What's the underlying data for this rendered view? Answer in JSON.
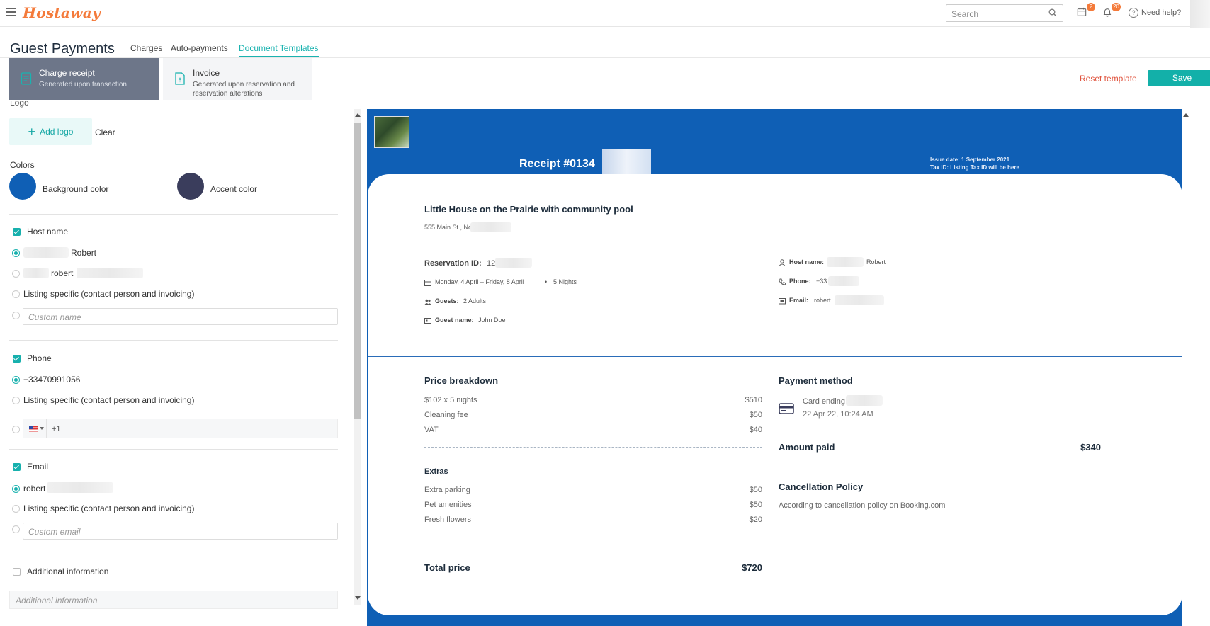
{
  "app": {
    "logo_text": "Hostaway",
    "search_placeholder": "Search",
    "calendar_badge": "2",
    "notifications_badge": "20",
    "help_label": "Need help?"
  },
  "page": {
    "title": "Guest Payments",
    "tabs": [
      {
        "label": "Charges"
      },
      {
        "label": "Auto-payments"
      },
      {
        "label": "Document Templates"
      }
    ]
  },
  "templates": [
    {
      "title": "Charge receipt",
      "subtitle": "Generated upon transaction"
    },
    {
      "title": "Invoice",
      "subtitle": "Generated upon reservation and reservation alterations"
    }
  ],
  "actions": {
    "reset_label": "Reset template",
    "save_label": "Save"
  },
  "editor": {
    "logo_label": "Logo",
    "add_logo_label": "Add logo",
    "clear_label": "Clear",
    "colors_label": "Colors",
    "background_color_label": "Background color",
    "accent_color_label": "Accent color",
    "background_color": "#0f5fb5",
    "accent_color": "#3a3d5c",
    "host_name": {
      "label": "Host name",
      "option1": "Robert",
      "option2": "robert",
      "option3": "Listing specific (contact person and invoicing)",
      "custom_placeholder": "Custom name"
    },
    "phone": {
      "label": "Phone",
      "option1": "+33470991056",
      "option2": "Listing specific (contact person and invoicing)",
      "custom_prefix": "+1"
    },
    "email": {
      "label": "Email",
      "option1": "robert",
      "option2": "Listing specific (contact person and invoicing)",
      "custom_placeholder": "Custom email"
    },
    "additional": {
      "label": "Additional information",
      "placeholder": "Additional information"
    }
  },
  "receipt": {
    "receipt_number": "Receipt #0134",
    "issue_date": "Issue date:  1 September 2021",
    "tax_id": "Tax ID: Listing Tax ID will be here",
    "property_name": "Little House on the Prairie with community pool",
    "address": "555 Main St., Nor",
    "reservation_id_label": "Reservation ID:",
    "reservation_id_value": "12",
    "dates": "Monday, 4 April – Friday, 8 April",
    "nights": "5 Nights",
    "guests_label": "Guests:",
    "guests_value": "2 Adults",
    "guest_name_label": "Guest name:",
    "guest_name_value": "John Doe",
    "host_name_label": "Host name:",
    "host_name_value": "Robert",
    "phone_label": "Phone:",
    "phone_value": "+33",
    "email_label": "Email:",
    "email_value": "robert",
    "price_breakdown_title": "Price breakdown",
    "price_items": [
      {
        "label": "$102 x 5 nights",
        "amount": "$510"
      },
      {
        "label": "Cleaning fee",
        "amount": "$50"
      },
      {
        "label": "VAT",
        "amount": "$40"
      }
    ],
    "extras_title": "Extras",
    "extras": [
      {
        "label": "Extra parking",
        "amount": "$50"
      },
      {
        "label": "Pet amenities",
        "amount": "$50"
      },
      {
        "label": "Fresh flowers",
        "amount": "$20"
      }
    ],
    "total_label": "Total price",
    "total_value": "$720",
    "payment_method_title": "Payment method",
    "card_text": "Card ending",
    "card_date": "22 Apr 22, 10:24 AM",
    "amount_paid_label": "Amount paid",
    "amount_paid_value": "$340",
    "cancellation_title": "Cancellation Policy",
    "cancellation_text": "According to cancellation policy on Booking.com"
  }
}
